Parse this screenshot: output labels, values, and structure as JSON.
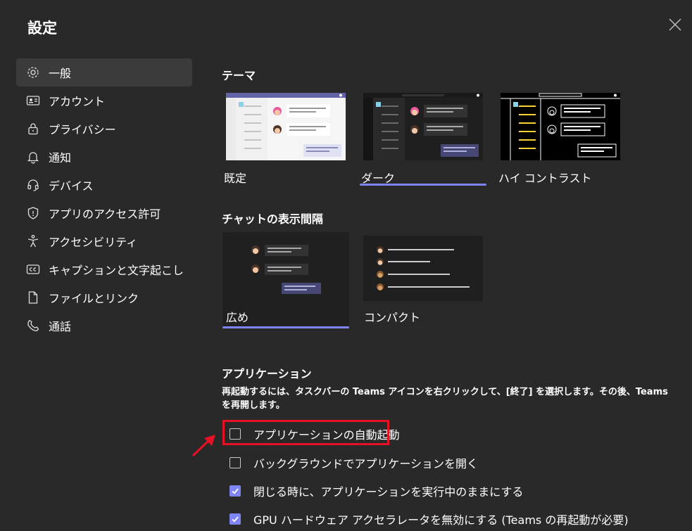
{
  "window": {
    "title": "設定"
  },
  "sidebar": {
    "items": [
      {
        "label": "一般",
        "icon": "gear-icon"
      },
      {
        "label": "アカウント",
        "icon": "id-card-icon"
      },
      {
        "label": "プライバシー",
        "icon": "lock-icon"
      },
      {
        "label": "通知",
        "icon": "bell-icon"
      },
      {
        "label": "デバイス",
        "icon": "headset-icon"
      },
      {
        "label": "アプリのアクセス許可",
        "icon": "shield-icon"
      },
      {
        "label": "アクセシビリティ",
        "icon": "accessibility-icon"
      },
      {
        "label": "キャプションと文字起こし",
        "icon": "cc-icon"
      },
      {
        "label": "ファイルとリンク",
        "icon": "file-icon"
      },
      {
        "label": "通話",
        "icon": "phone-icon"
      }
    ],
    "active_index": 0
  },
  "theme": {
    "title": "テーマ",
    "options": [
      {
        "label": "既定"
      },
      {
        "label": "ダーク"
      },
      {
        "label": "ハイ コントラスト"
      }
    ],
    "selected": "ダーク"
  },
  "density": {
    "title": "チャットの表示間隔",
    "options": [
      {
        "label": "広め"
      },
      {
        "label": "コンパクト"
      }
    ],
    "selected": "広め"
  },
  "application": {
    "title": "アプリケーション",
    "note": "再起動するには、タスクバーの Teams アイコンを右クリックして、[終了] を選択します。その後、Teams を再開します。",
    "options": [
      {
        "label": "アプリケーションの自動起動",
        "checked": false
      },
      {
        "label": "バックグラウンドでアプリケーションを開く",
        "checked": false
      },
      {
        "label": "閉じる時に、アプリケーションを実行中のままにする",
        "checked": true
      },
      {
        "label": "GPU ハードウェア アクセラレータを無効にする (Teams の再起動が必要)",
        "checked": true
      }
    ]
  },
  "colors": {
    "background": "#292929",
    "accent": "#7f85f5",
    "highlight": "#e81123"
  }
}
